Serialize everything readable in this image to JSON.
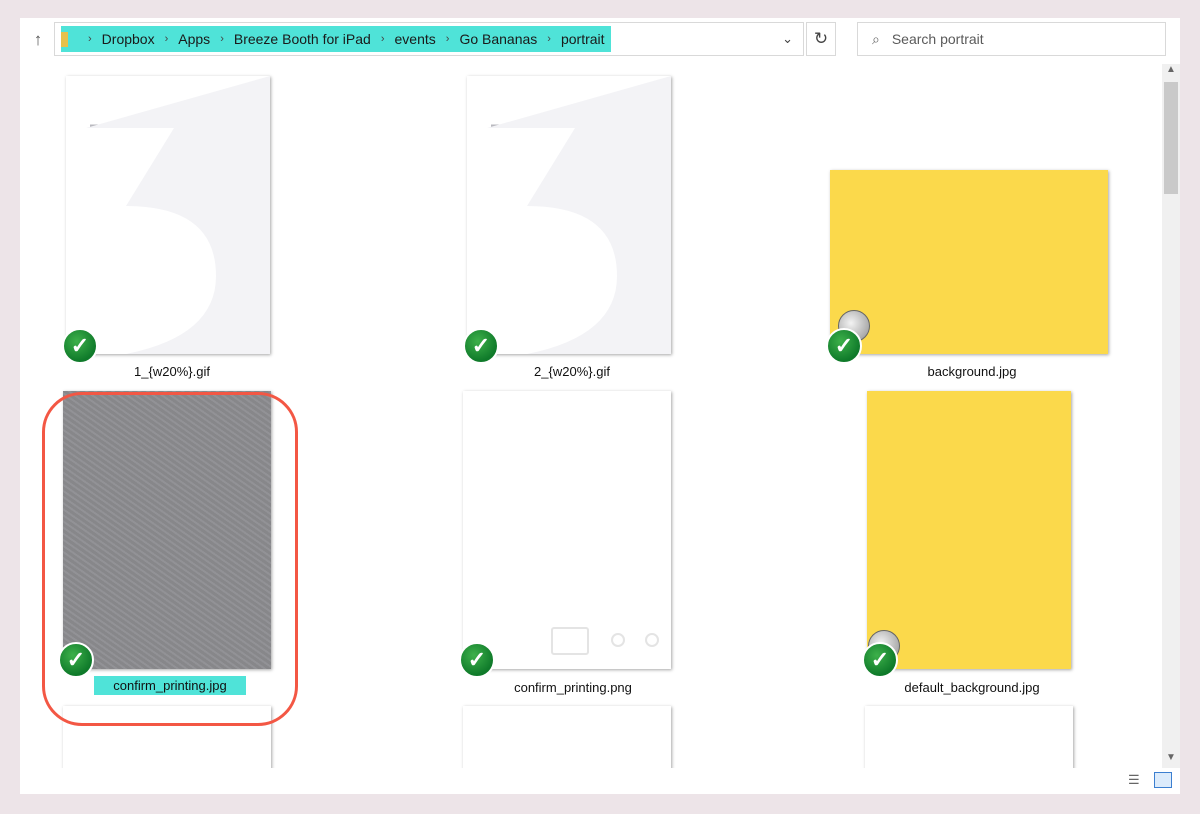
{
  "nav": {
    "up_glyph": "↑",
    "breadcrumb": [
      "Dropbox",
      "Apps",
      "Breeze Booth for iPad",
      "events",
      "Go Bananas",
      "portrait"
    ],
    "separator_glyph": "›",
    "dropdown_glyph": "⌄",
    "refresh_glyph": "↻"
  },
  "search": {
    "placeholder": "Search portrait",
    "icon": "search-icon",
    "glyph": "⌕"
  },
  "files": [
    {
      "name": "1_{w20%}.gif",
      "thumb": "number-3-white",
      "sync_status": "synced"
    },
    {
      "name": "2_{w20%}.gif",
      "thumb": "number-3-white",
      "sync_status": "synced"
    },
    {
      "name": "background.jpg",
      "thumb": "yellow-landscape",
      "sync_status": "synced"
    },
    {
      "name": "confirm_printing.jpg",
      "thumb": "gray-texture",
      "sync_status": "synced",
      "selected": true
    },
    {
      "name": "confirm_printing.png",
      "thumb": "white-overlay",
      "sync_status": "synced"
    },
    {
      "name": "default_background.jpg",
      "thumb": "yellow-portrait",
      "sync_status": "synced"
    }
  ],
  "check_glyph": "✓",
  "colors": {
    "highlight_ring": "#f35744",
    "selection": "#4fe3d8",
    "thumb_yellow": "#fbd94b",
    "sync_green": "#1d8f33"
  },
  "scroll": {
    "up_glyph": "▲",
    "down_glyph": "▼"
  },
  "view_modes": {
    "details_icon": "details-view-icon",
    "details_glyph": "☰",
    "large_icons_icon": "large-icons-view-icon"
  }
}
